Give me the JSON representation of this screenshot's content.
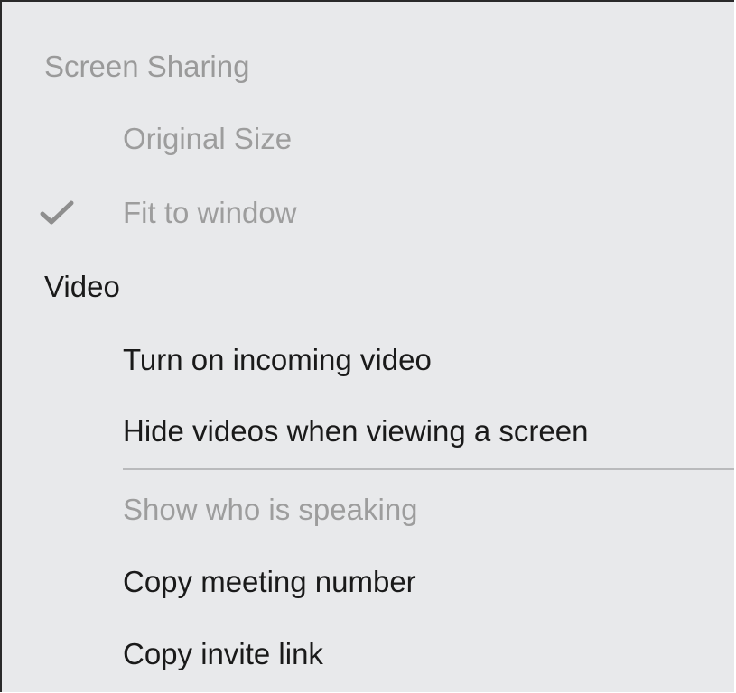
{
  "menu": {
    "screen_sharing": {
      "header": "Screen Sharing",
      "items": [
        {
          "label": "Original Size",
          "checked": false,
          "enabled": false
        },
        {
          "label": "Fit to window",
          "checked": true,
          "enabled": false
        }
      ]
    },
    "video": {
      "header": "Video",
      "items": [
        {
          "label": "Turn on incoming video",
          "enabled": true
        },
        {
          "label": "Hide videos when viewing a screen",
          "enabled": true
        }
      ]
    },
    "other_items": [
      {
        "label": "Show who is speaking",
        "enabled": false
      },
      {
        "label": "Copy meeting number",
        "enabled": true
      },
      {
        "label": "Copy invite link",
        "enabled": true
      }
    ],
    "check_icon": "checkmark-icon",
    "colors": {
      "background": "#e8e9eb",
      "enabled_text": "#1a1a1a",
      "disabled_text": "#9d9d9d",
      "separator": "#b9babc"
    }
  }
}
